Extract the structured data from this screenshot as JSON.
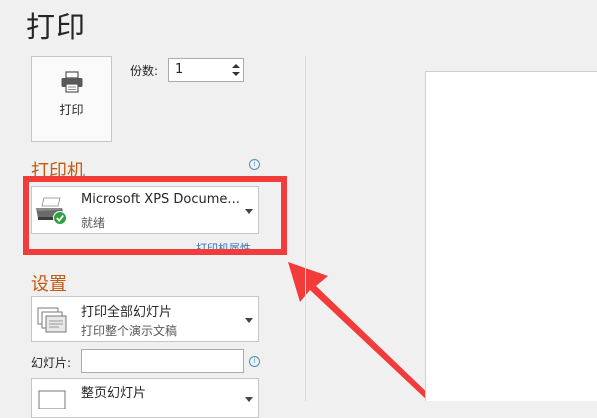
{
  "page": {
    "title": "打印"
  },
  "print_button": {
    "label": "打印"
  },
  "copies": {
    "label": "份数:",
    "value": "1"
  },
  "printer": {
    "heading": "打印机",
    "name": "Microsoft XPS Docume...",
    "status": "就绪",
    "properties_link": "打印机属性"
  },
  "settings": {
    "heading": "设置",
    "range": {
      "title": "打印全部幻灯片",
      "subtitle": "打印整个演示文稿"
    },
    "slides_label": "幻灯片:",
    "slides_value": "",
    "layout": {
      "title": "整页幻灯片"
    }
  },
  "colors": {
    "accent": "#c55a11",
    "link": "#2e75b6",
    "highlight": "#f23b3b"
  },
  "icons": [
    "printer-icon",
    "info-icon",
    "chevron-down-icon",
    "slides-icon"
  ]
}
